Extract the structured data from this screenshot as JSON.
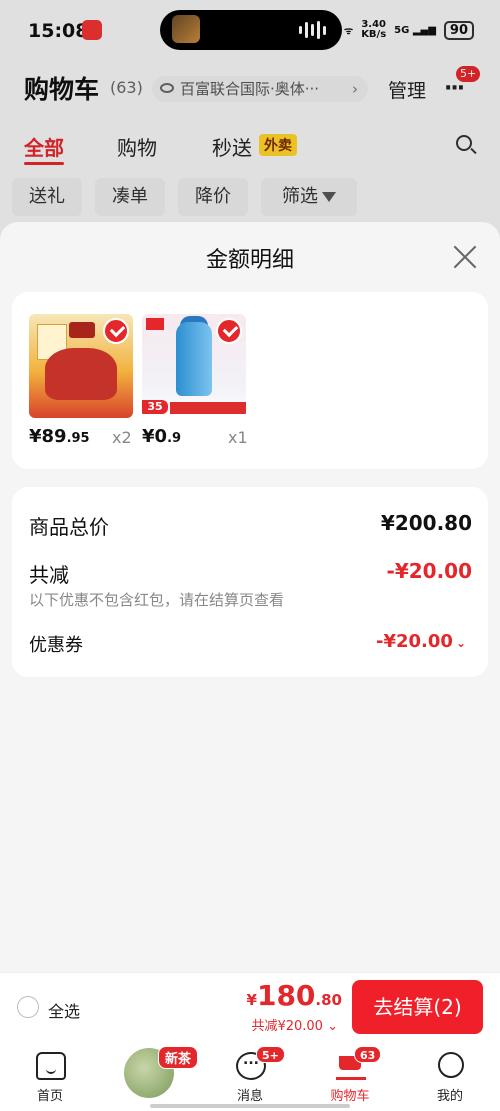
{
  "status_bar": {
    "time": "15:08",
    "net_speed": "3.40",
    "net_unit": "KB/s",
    "net_gen": "5G",
    "battery": "90"
  },
  "header": {
    "title": "购物车",
    "count": "(63)",
    "address": "百富联合国际·奥体···",
    "manage": "管理",
    "more_badge": "5+"
  },
  "tabs": [
    {
      "label": "全部"
    },
    {
      "label": "购物"
    },
    {
      "label": "秒送"
    }
  ],
  "tab_tag": "外卖",
  "chips": [
    "送礼",
    "凑单",
    "降价",
    "筛选"
  ],
  "sheet": {
    "title": "金额明细",
    "products": [
      {
        "price_int": "¥89",
        "price_dec": ".95",
        "qty": "x2"
      },
      {
        "price_int": "¥0",
        "price_dec": ".9",
        "qty": "x1"
      }
    ],
    "product2_tag": "35",
    "summary": {
      "total_label": "商品总价",
      "total_value": "¥200.80",
      "reduce_label": "共减",
      "reduce_value": "-¥20.00",
      "note": "以下优惠不包含红包，请在结算页查看",
      "coupon_label": "优惠券",
      "coupon_value": "-¥20.00"
    }
  },
  "checkout": {
    "select_all": "全选",
    "currency": "¥",
    "total_int": "180",
    "total_dec": ".80",
    "discount": "共减¥20.00",
    "button": "去结算(2)"
  },
  "nav": {
    "promo_badge": "新茶",
    "items": [
      {
        "label": "首页"
      },
      {
        "label": "消息",
        "badge": "5+"
      },
      {
        "label": "购物车",
        "badge": "63"
      },
      {
        "label": "我的"
      }
    ]
  },
  "colors": {
    "accent": "#e4272b",
    "button": "#f0202a",
    "background": "#f5f5f5"
  },
  "icons": [
    "search-icon",
    "close-icon",
    "eye-icon",
    "filter-icon",
    "home-icon",
    "message-icon",
    "cart-icon",
    "profile-icon",
    "check-icon"
  ]
}
